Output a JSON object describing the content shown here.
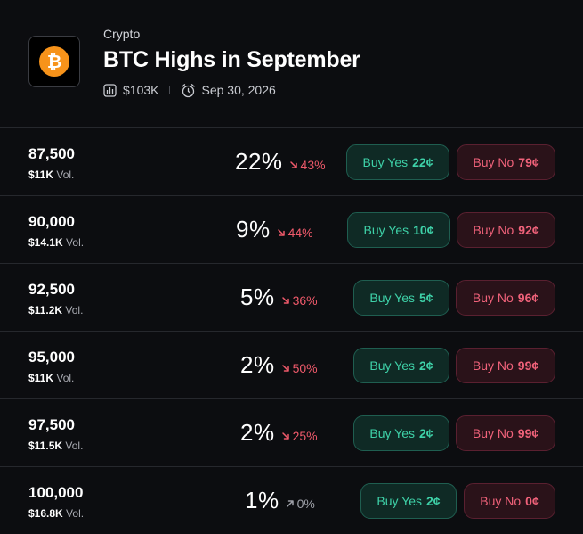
{
  "header": {
    "category": "Crypto",
    "title": "BTC Highs in September",
    "volume": "$103K",
    "end_date": "Sep 30, 2026",
    "logo_icon": "bitcoin-icon",
    "accent": "#f7931a"
  },
  "vol_suffix": "Vol.",
  "buy_yes_label": "Buy Yes",
  "buy_no_label": "Buy No",
  "colors": {
    "yes": "#3ed1a8",
    "no": "#f0627a",
    "change_down": "#f05a6b",
    "change_flat": "#9ea0a8"
  },
  "markets": [
    {
      "label": "87,500",
      "volume": "$11K",
      "chance": "22%",
      "change": "43%",
      "direction": "down",
      "yes_price": "22¢",
      "no_price": "79¢"
    },
    {
      "label": "90,000",
      "volume": "$14.1K",
      "chance": "9%",
      "change": "44%",
      "direction": "down",
      "yes_price": "10¢",
      "no_price": "92¢"
    },
    {
      "label": "92,500",
      "volume": "$11.2K",
      "chance": "5%",
      "change": "36%",
      "direction": "down",
      "yes_price": "5¢",
      "no_price": "96¢"
    },
    {
      "label": "95,000",
      "volume": "$11K",
      "chance": "2%",
      "change": "50%",
      "direction": "down",
      "yes_price": "2¢",
      "no_price": "99¢"
    },
    {
      "label": "97,500",
      "volume": "$11.5K",
      "chance": "2%",
      "change": "25%",
      "direction": "down",
      "yes_price": "2¢",
      "no_price": "99¢"
    },
    {
      "label": "100,000",
      "volume": "$16.8K",
      "chance": "1%",
      "change": "0%",
      "direction": "up",
      "yes_price": "2¢",
      "no_price": "0¢"
    }
  ]
}
